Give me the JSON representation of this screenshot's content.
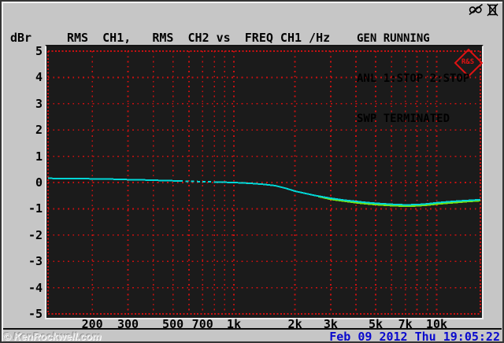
{
  "colors": {
    "bezel_bg": "#c6c6c6",
    "screen_black": "#1b1b1b",
    "grid_red": "#cc1010",
    "trace_ch1_cyan": "#00d7d7",
    "trace_ch2_green": "#79e512",
    "timestamp_blue": "#0a0acd",
    "logo_red": "#e01212",
    "text_black": "#000000"
  },
  "status_panel": {
    "line1": "GEN RUNNING",
    "line2": "ANL 1:STOP 2:STOP",
    "line3": "SWP TERMINATED"
  },
  "header": {
    "y_unit_label": "dBr",
    "trace_title": "RMS  CH1,   RMS  CH2 vs  FREQ CH1 /Hz"
  },
  "logo_text": "R&S",
  "footer": {
    "watermark": "© KenRockwell.com",
    "datetime": "Feb 09 2012 Thu 19:05:22"
  },
  "chart_data": {
    "type": "line",
    "title": "RMS CH1, RMS CH2 vs FREQ CH1 /Hz",
    "xlabel": "FREQ CH1 /Hz",
    "ylabel": "dBr",
    "x_scale": "log",
    "xlim": [
      121,
      16430
    ],
    "ylim": [
      -5,
      5
    ],
    "grid": true,
    "legend_position": "none",
    "y_ticks": [
      5,
      4,
      3,
      2,
      1,
      0,
      -1,
      -2,
      -3,
      -4,
      -5
    ],
    "x_grid_freqs": [
      200,
      300,
      400,
      500,
      600,
      700,
      800,
      900,
      1000,
      2000,
      3000,
      4000,
      5000,
      6000,
      7000,
      8000,
      9000,
      10000
    ],
    "x_tick_labels": [
      {
        "f": 200,
        "label": "200"
      },
      {
        "f": 300,
        "label": "300"
      },
      {
        "f": 500,
        "label": "500"
      },
      {
        "f": 700,
        "label": "700"
      },
      {
        "f": 1000,
        "label": "1k"
      },
      {
        "f": 2000,
        "label": "2k"
      },
      {
        "f": 3000,
        "label": "3k"
      },
      {
        "f": 5000,
        "label": "5k"
      },
      {
        "f": 7000,
        "label": "7k"
      },
      {
        "f": 10000,
        "label": "10k"
      }
    ],
    "series": [
      {
        "name": "RMS CH1",
        "color": "#00d7d7",
        "dash_segment": [
          540,
          800
        ],
        "points": [
          [
            121,
            0.16
          ],
          [
            160,
            0.15
          ],
          [
            200,
            0.14
          ],
          [
            250,
            0.13
          ],
          [
            300,
            0.11
          ],
          [
            360,
            0.1
          ],
          [
            430,
            0.08
          ],
          [
            540,
            0.06
          ],
          [
            650,
            0.04
          ],
          [
            800,
            0.02
          ],
          [
            1000,
            0.0
          ],
          [
            1200,
            -0.03
          ],
          [
            1400,
            -0.07
          ],
          [
            1600,
            -0.12
          ],
          [
            1800,
            -0.22
          ],
          [
            2000,
            -0.33
          ],
          [
            2500,
            -0.49
          ],
          [
            3000,
            -0.6
          ],
          [
            3500,
            -0.67
          ],
          [
            4000,
            -0.72
          ],
          [
            4500,
            -0.76
          ],
          [
            5000,
            -0.79
          ],
          [
            6000,
            -0.83
          ],
          [
            7000,
            -0.85
          ],
          [
            8000,
            -0.84
          ],
          [
            9000,
            -0.81
          ],
          [
            10000,
            -0.77
          ],
          [
            11500,
            -0.73
          ],
          [
            13000,
            -0.7
          ],
          [
            14500,
            -0.68
          ],
          [
            16000,
            -0.66
          ],
          [
            16430,
            -0.65
          ]
        ]
      },
      {
        "name": "RMS CH2",
        "color": "#79e512",
        "points": [
          [
            2600,
            -0.53
          ],
          [
            3000,
            -0.64
          ],
          [
            3500,
            -0.71
          ],
          [
            4000,
            -0.77
          ],
          [
            4500,
            -0.81
          ],
          [
            5000,
            -0.84
          ],
          [
            6000,
            -0.88
          ],
          [
            7000,
            -0.9
          ],
          [
            8000,
            -0.89
          ],
          [
            9000,
            -0.86
          ],
          [
            10000,
            -0.82
          ],
          [
            11500,
            -0.78
          ],
          [
            13000,
            -0.75
          ],
          [
            14500,
            -0.72
          ],
          [
            16000,
            -0.7
          ],
          [
            16430,
            -0.69
          ]
        ]
      }
    ]
  }
}
